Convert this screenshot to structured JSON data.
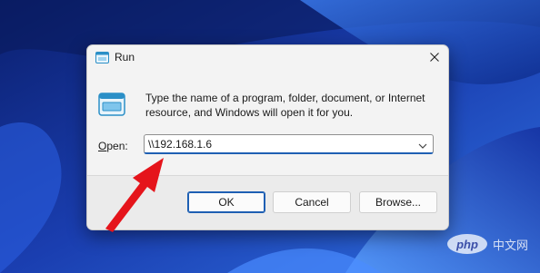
{
  "window": {
    "title": "Run",
    "description": "Type the name of a program, folder, document, or Internet resource, and Windows will open it for you."
  },
  "open_field": {
    "label_underlined": "O",
    "label_rest": "pen:",
    "value": "\\\\192.168.1.6"
  },
  "buttons": {
    "ok": "OK",
    "cancel": "Cancel",
    "browse": "Browse..."
  },
  "watermark": {
    "logo_text": "php",
    "text": "中文网"
  },
  "colors": {
    "accent": "#1e5fb3",
    "annotation_arrow": "#e5141b",
    "desktop_base": "#1c3fa8"
  },
  "icons": [
    "run-app-icon",
    "close-icon",
    "chevron-down-icon",
    "red-arrow-annotation-icon"
  ]
}
